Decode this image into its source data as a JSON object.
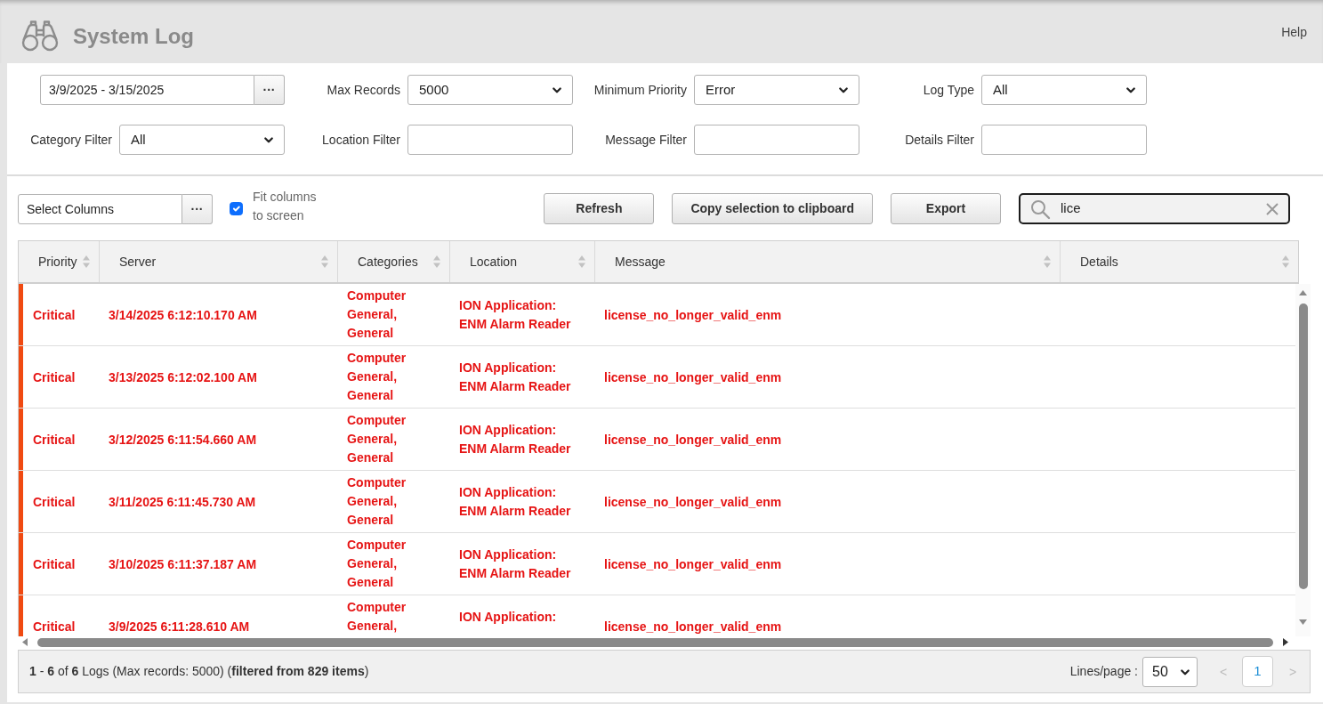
{
  "header": {
    "title": "System Log",
    "help_link": "Help"
  },
  "filters": [
    {
      "kind": "daterange",
      "value": "3/9/2025 - 3/15/2025",
      "button": "···"
    },
    {
      "kind": "select",
      "label": "Max Records",
      "value": "5000"
    },
    {
      "kind": "select",
      "label": "Minimum Priority",
      "value": "Error"
    },
    {
      "kind": "select",
      "label": "Log Type",
      "value": "All"
    },
    {
      "kind": "select",
      "label": "Category Filter",
      "value": "All"
    },
    {
      "kind": "text",
      "label": "Location Filter"
    },
    {
      "kind": "text",
      "label": "Message Filter"
    },
    {
      "kind": "text",
      "label": "Details Filter"
    }
  ],
  "toolbar": {
    "column_picker": {
      "value": "Select Columns",
      "button": "···"
    },
    "fit_columns": {
      "label": "Fit columns to screen",
      "checked": true
    },
    "buttons": [
      "Refresh",
      "Copy selection to clipboard",
      "Export"
    ],
    "search": {
      "value": "lice",
      "focused": true
    }
  },
  "table": {
    "columns": [
      "Priority",
      "Server",
      "Categories",
      "Location",
      "Message",
      "Details"
    ],
    "rows": [
      {
        "kind": "critical",
        "cells": [
          "Critical",
          "3/14/2025 6:12:10.170 AM",
          "Computer General, General",
          "ION Application: ENM Alarm Reader",
          "license_no_longer_valid_enm"
        ]
      },
      {
        "kind": "critical",
        "cells": [
          "Critical",
          "3/13/2025 6:12:02.100 AM",
          "Computer General, General",
          "ION Application: ENM Alarm Reader",
          "license_no_longer_valid_enm"
        ]
      },
      {
        "kind": "critical",
        "cells": [
          "Critical",
          "3/12/2025 6:11:54.660 AM",
          "Computer General, General",
          "ION Application: ENM Alarm Reader",
          "license_no_longer_valid_enm"
        ]
      },
      {
        "kind": "critical",
        "cells": [
          "Critical",
          "3/11/2025 6:11:45.730 AM",
          "Computer General, General",
          "ION Application: ENM Alarm Reader",
          "license_no_longer_valid_enm"
        ]
      },
      {
        "kind": "critical",
        "cells": [
          "Critical",
          "3/10/2025 6:11:37.187 AM",
          "Computer General, General",
          "ION Application: ENM Alarm Reader",
          "license_no_longer_valid_enm"
        ]
      },
      {
        "kind": "critical",
        "cells": [
          "Critical",
          "3/9/2025 6:11:28.610 AM",
          "Computer General,",
          "ION Application:",
          "license_no_longer_valid_enm"
        ]
      }
    ]
  },
  "footer": {
    "summary": "**1** - **6** of **6** Logs (Max records: 5000) (**filtered from 829 items**)",
    "lines_per_page": {
      "label": "Lines/page :",
      "value": "50"
    },
    "pager": {
      "previous": {
        "label": "<",
        "disabled": true
      },
      "pages": [
        {
          "label": "1",
          "selected": true
        }
      ],
      "next": {
        "label": ">",
        "disabled": true
      }
    }
  }
}
